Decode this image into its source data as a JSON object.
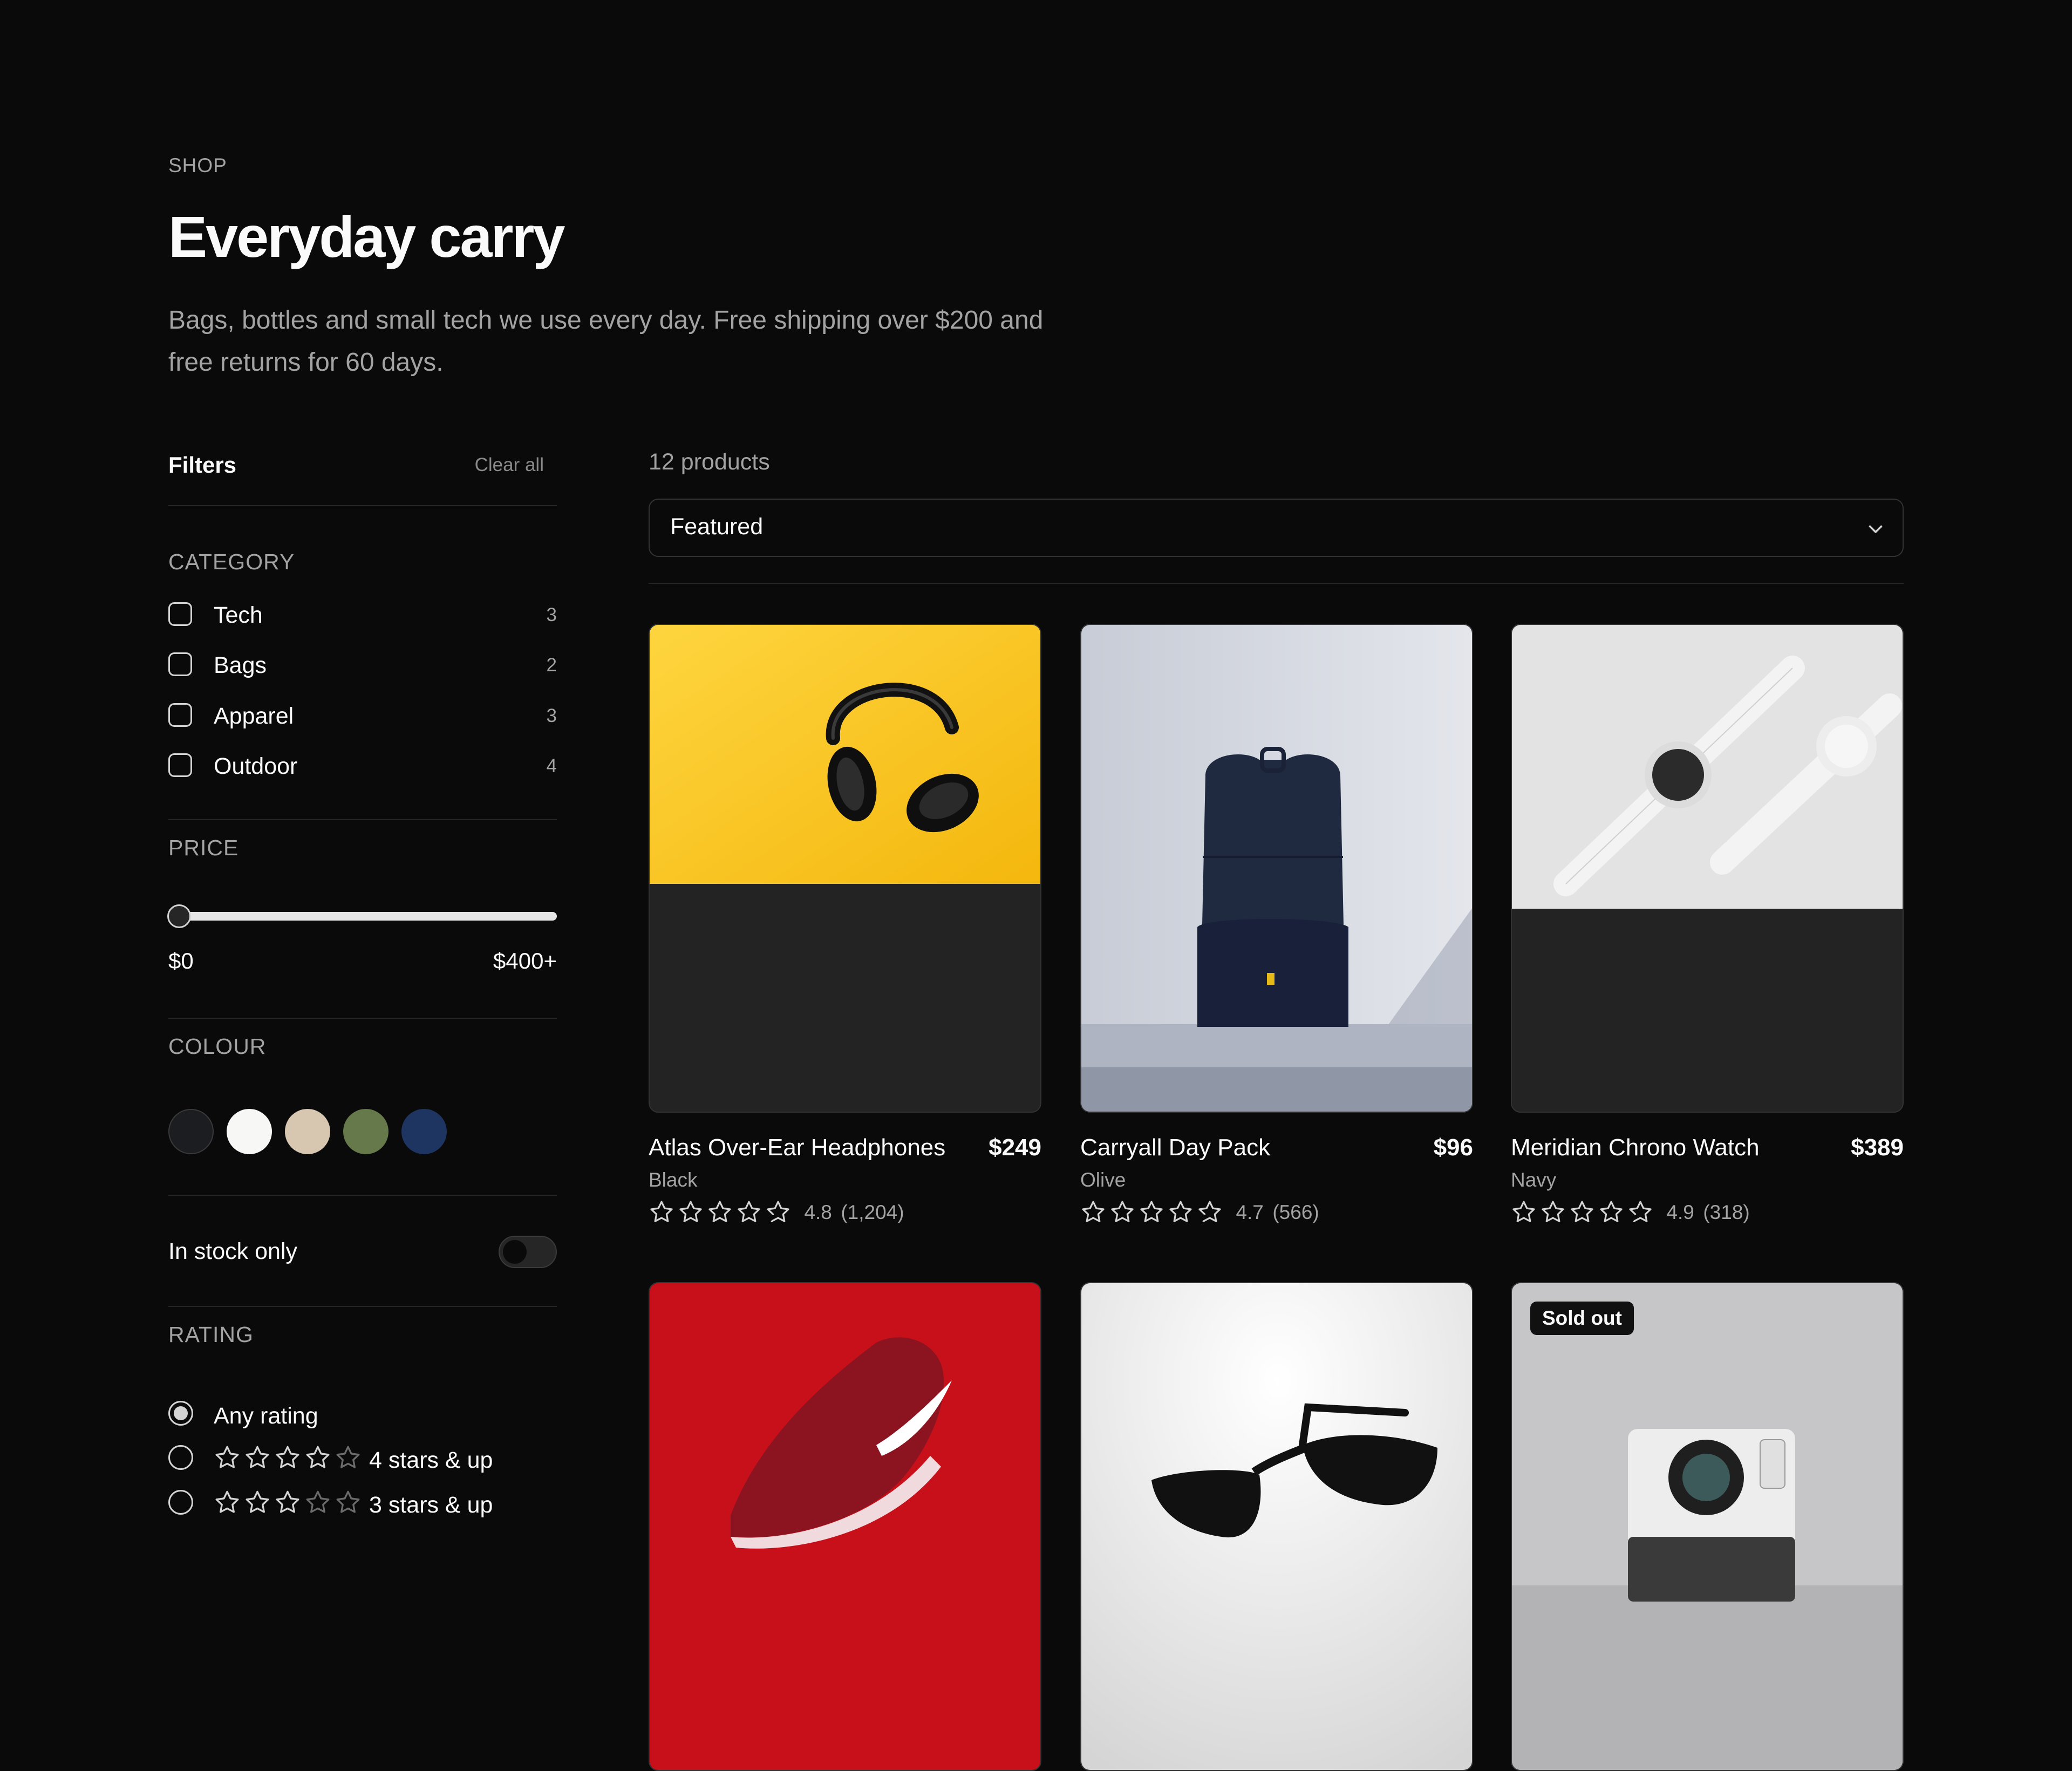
{
  "header": {
    "eyebrow": "SHOP",
    "title": "Everyday carry",
    "subtitle": "Bags, bottles and small tech we use every day. Free shipping over $200 and free returns for 60 days."
  },
  "filters": {
    "title": "Filters",
    "clear_label": "Clear all",
    "category": {
      "title": "CATEGORY",
      "items": [
        {
          "label": "Tech",
          "count": "3"
        },
        {
          "label": "Bags",
          "count": "2"
        },
        {
          "label": "Apparel",
          "count": "3"
        },
        {
          "label": "Outdoor",
          "count": "4"
        }
      ]
    },
    "price": {
      "title": "PRICE",
      "min_label": "$0",
      "max_label": "$400+",
      "value_fraction": 0
    },
    "colour": {
      "title": "COLOUR",
      "swatches": [
        {
          "name": "Black",
          "color": "#1c1d20"
        },
        {
          "name": "White",
          "color": "#f7f7f5"
        },
        {
          "name": "Sand",
          "color": "#d8c7b0"
        },
        {
          "name": "Olive",
          "color": "#66794a"
        },
        {
          "name": "Navy",
          "color": "#1f3561"
        }
      ]
    },
    "stock": {
      "label": "In stock only",
      "enabled": false
    },
    "rating": {
      "title": "RATING",
      "options": [
        {
          "label": "Any rating",
          "stars": 0,
          "selected": true
        },
        {
          "label": "4 stars & up",
          "stars": 4,
          "selected": false
        },
        {
          "label": "3 stars & up",
          "stars": 3,
          "selected": false
        }
      ]
    }
  },
  "results": {
    "count_label": "12 products",
    "sort_selected": "Featured"
  },
  "products": [
    {
      "name": "Atlas Over-Ear Headphones",
      "price": "$249",
      "color": "Black",
      "rating": "4.8",
      "reviews": "(1,204)",
      "stars": 4.8,
      "image": "headphones-photo",
      "badge": ""
    },
    {
      "name": "Carryall Day Pack",
      "price": "$96",
      "color": "Olive",
      "rating": "4.7",
      "reviews": "(566)",
      "stars": 4.7,
      "image": "backpack-photo",
      "badge": ""
    },
    {
      "name": "Meridian Chrono Watch",
      "price": "$389",
      "color": "Navy",
      "rating": "4.9",
      "reviews": "(318)",
      "stars": 4.9,
      "image": "watch-photo",
      "badge": ""
    },
    {
      "name": "",
      "price": "",
      "color": "",
      "image": "sneaker-photo",
      "badge": ""
    },
    {
      "name": "",
      "price": "",
      "color": "",
      "image": "sunglasses-photo",
      "badge": ""
    },
    {
      "name": "",
      "price": "",
      "color": "",
      "image": "camera-photo",
      "badge": "Sold out"
    }
  ]
}
